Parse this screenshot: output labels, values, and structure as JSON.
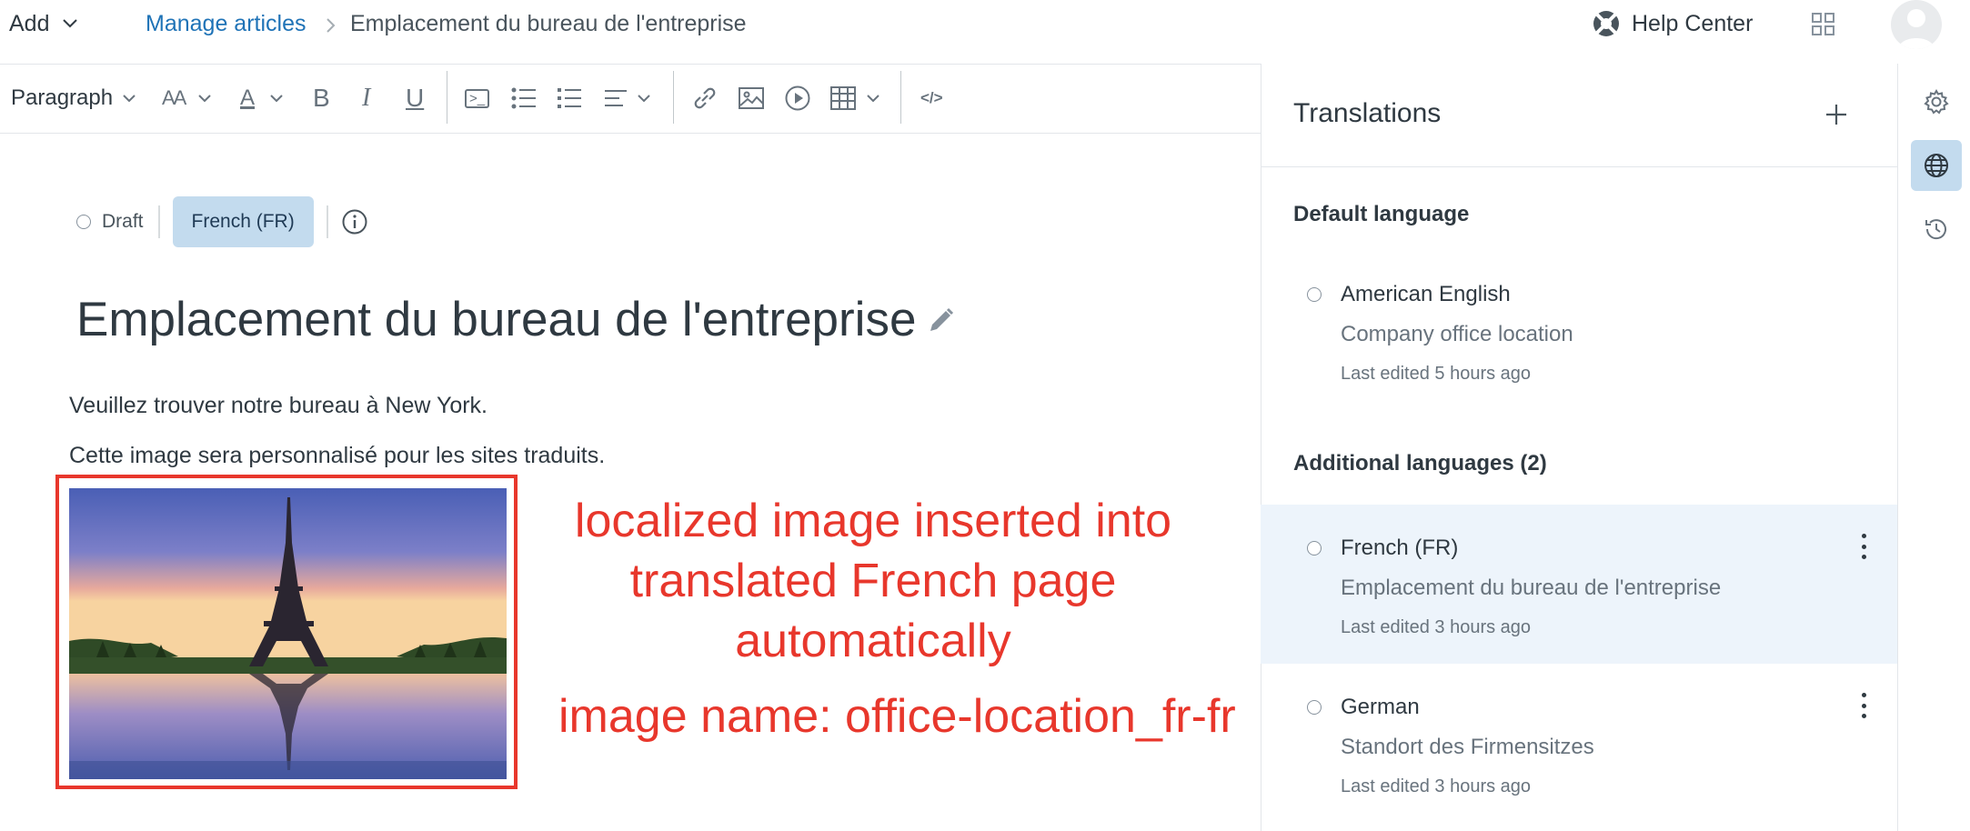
{
  "topbar": {
    "add_label": "Add",
    "breadcrumb_link": "Manage articles",
    "breadcrumb_current": "Emplacement du bureau de l'entreprise",
    "help_center_label": "Help Center"
  },
  "toolbar": {
    "paragraph_label": "Paragraph",
    "font_size_glyph": "AA",
    "font_color_glyph": "A",
    "bold_glyph": "B",
    "italic_glyph": "I",
    "underline_glyph": "U",
    "code_block_glyph": ">_",
    "source_glyph": "</>"
  },
  "editor": {
    "status_draft": "Draft",
    "language_pill": "French (FR)",
    "title": "Emplacement du bureau de l'entreprise",
    "paragraphs": [
      "Veuillez trouver notre bureau à New York.",
      "Cette image sera personnalisé pour les sites traduits."
    ],
    "annotation_lines": [
      "localized image inserted into",
      "translated French page",
      "automatically"
    ],
    "annotation_image_name": "image name: office-location_fr-fr",
    "annotation_color": "#e8372c"
  },
  "translations": {
    "title": "Translations",
    "default_heading": "Default language",
    "additional_heading": "Additional languages (2)",
    "default_language": {
      "name": "American English",
      "title": "Company office location",
      "edited": "Last edited 5 hours ago"
    },
    "additional_languages": [
      {
        "name": "French (FR)",
        "title": "Emplacement du bureau de l'entreprise",
        "edited": "Last edited 3 hours ago",
        "selected": true
      },
      {
        "name": "German",
        "title": "Standort des Firmensitzes",
        "edited": "Last edited 3 hours ago",
        "selected": false
      }
    ]
  },
  "colors": {
    "link": "#1f73b7",
    "selected_bg": "#c3dbee",
    "selected_row_bg": "#edf4fb"
  },
  "icons": [
    "chevron-down-icon",
    "chevron-right-icon",
    "help-center-icon",
    "apps-grid-icon",
    "avatar-icon",
    "bulleted-list-icon",
    "numbered-list-icon",
    "align-icon",
    "link-icon",
    "image-icon",
    "video-icon",
    "table-icon",
    "info-icon",
    "pencil-icon",
    "plus-icon",
    "kebab-icon",
    "gear-icon",
    "globe-icon",
    "history-icon"
  ]
}
